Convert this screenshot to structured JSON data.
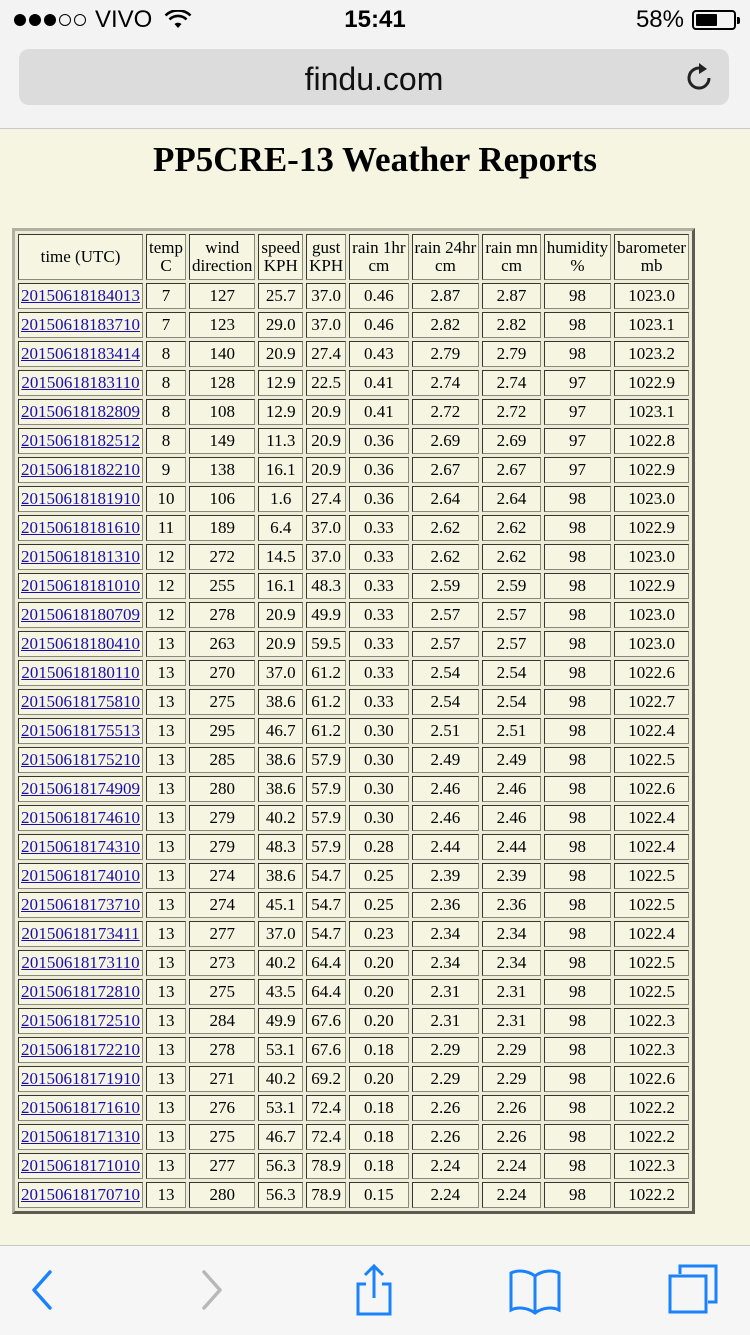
{
  "status": {
    "carrier": "VIVO",
    "time": "15:41",
    "battery": "58%",
    "battery_level": 0.58,
    "signal_bars": 3
  },
  "browser": {
    "url": "findu.com",
    "icons": {
      "reload": "reload-icon",
      "back": "back-chevron-icon",
      "forward": "forward-chevron-icon",
      "share": "share-icon",
      "bookmarks": "bookmarks-book-icon",
      "tabs": "tabs-icon"
    }
  },
  "page": {
    "title": "PP5CRE-13 Weather Reports",
    "columns": [
      [
        "time (UTC)"
      ],
      [
        "temp",
        "C"
      ],
      [
        "wind",
        "direction"
      ],
      [
        "speed",
        "KPH"
      ],
      [
        "gust",
        "KPH"
      ],
      [
        "rain 1hr",
        "cm"
      ],
      [
        "rain 24hr",
        "cm"
      ],
      [
        "rain mn",
        "cm"
      ],
      [
        "humidity",
        "%"
      ],
      [
        "barometer",
        "mb"
      ]
    ],
    "rows": [
      [
        "20150618184013",
        "7",
        "127",
        "25.7",
        "37.0",
        "0.46",
        "2.87",
        "2.87",
        "98",
        "1023.0"
      ],
      [
        "20150618183710",
        "7",
        "123",
        "29.0",
        "37.0",
        "0.46",
        "2.82",
        "2.82",
        "98",
        "1023.1"
      ],
      [
        "20150618183414",
        "8",
        "140",
        "20.9",
        "27.4",
        "0.43",
        "2.79",
        "2.79",
        "98",
        "1023.2"
      ],
      [
        "20150618183110",
        "8",
        "128",
        "12.9",
        "22.5",
        "0.41",
        "2.74",
        "2.74",
        "97",
        "1022.9"
      ],
      [
        "20150618182809",
        "8",
        "108",
        "12.9",
        "20.9",
        "0.41",
        "2.72",
        "2.72",
        "97",
        "1023.1"
      ],
      [
        "20150618182512",
        "8",
        "149",
        "11.3",
        "20.9",
        "0.36",
        "2.69",
        "2.69",
        "97",
        "1022.8"
      ],
      [
        "20150618182210",
        "9",
        "138",
        "16.1",
        "20.9",
        "0.36",
        "2.67",
        "2.67",
        "97",
        "1022.9"
      ],
      [
        "20150618181910",
        "10",
        "106",
        "1.6",
        "27.4",
        "0.36",
        "2.64",
        "2.64",
        "98",
        "1023.0"
      ],
      [
        "20150618181610",
        "11",
        "189",
        "6.4",
        "37.0",
        "0.33",
        "2.62",
        "2.62",
        "98",
        "1022.9"
      ],
      [
        "20150618181310",
        "12",
        "272",
        "14.5",
        "37.0",
        "0.33",
        "2.62",
        "2.62",
        "98",
        "1023.0"
      ],
      [
        "20150618181010",
        "12",
        "255",
        "16.1",
        "48.3",
        "0.33",
        "2.59",
        "2.59",
        "98",
        "1022.9"
      ],
      [
        "20150618180709",
        "12",
        "278",
        "20.9",
        "49.9",
        "0.33",
        "2.57",
        "2.57",
        "98",
        "1023.0"
      ],
      [
        "20150618180410",
        "13",
        "263",
        "20.9",
        "59.5",
        "0.33",
        "2.57",
        "2.57",
        "98",
        "1023.0"
      ],
      [
        "20150618180110",
        "13",
        "270",
        "37.0",
        "61.2",
        "0.33",
        "2.54",
        "2.54",
        "98",
        "1022.6"
      ],
      [
        "20150618175810",
        "13",
        "275",
        "38.6",
        "61.2",
        "0.33",
        "2.54",
        "2.54",
        "98",
        "1022.7"
      ],
      [
        "20150618175513",
        "13",
        "295",
        "46.7",
        "61.2",
        "0.30",
        "2.51",
        "2.51",
        "98",
        "1022.4"
      ],
      [
        "20150618175210",
        "13",
        "285",
        "38.6",
        "57.9",
        "0.30",
        "2.49",
        "2.49",
        "98",
        "1022.5"
      ],
      [
        "20150618174909",
        "13",
        "280",
        "38.6",
        "57.9",
        "0.30",
        "2.46",
        "2.46",
        "98",
        "1022.6"
      ],
      [
        "20150618174610",
        "13",
        "279",
        "40.2",
        "57.9",
        "0.30",
        "2.46",
        "2.46",
        "98",
        "1022.4"
      ],
      [
        "20150618174310",
        "13",
        "279",
        "48.3",
        "57.9",
        "0.28",
        "2.44",
        "2.44",
        "98",
        "1022.4"
      ],
      [
        "20150618174010",
        "13",
        "274",
        "38.6",
        "54.7",
        "0.25",
        "2.39",
        "2.39",
        "98",
        "1022.5"
      ],
      [
        "20150618173710",
        "13",
        "274",
        "45.1",
        "54.7",
        "0.25",
        "2.36",
        "2.36",
        "98",
        "1022.5"
      ],
      [
        "20150618173411",
        "13",
        "277",
        "37.0",
        "54.7",
        "0.23",
        "2.34",
        "2.34",
        "98",
        "1022.4"
      ],
      [
        "20150618173110",
        "13",
        "273",
        "40.2",
        "64.4",
        "0.20",
        "2.34",
        "2.34",
        "98",
        "1022.5"
      ],
      [
        "20150618172810",
        "13",
        "275",
        "43.5",
        "64.4",
        "0.20",
        "2.31",
        "2.31",
        "98",
        "1022.5"
      ],
      [
        "20150618172510",
        "13",
        "284",
        "49.9",
        "67.6",
        "0.20",
        "2.31",
        "2.31",
        "98",
        "1022.3"
      ],
      [
        "20150618172210",
        "13",
        "278",
        "53.1",
        "67.6",
        "0.18",
        "2.29",
        "2.29",
        "98",
        "1022.3"
      ],
      [
        "20150618171910",
        "13",
        "271",
        "40.2",
        "69.2",
        "0.20",
        "2.29",
        "2.29",
        "98",
        "1022.6"
      ],
      [
        "20150618171610",
        "13",
        "276",
        "53.1",
        "72.4",
        "0.18",
        "2.26",
        "2.26",
        "98",
        "1022.2"
      ],
      [
        "20150618171310",
        "13",
        "275",
        "46.7",
        "72.4",
        "0.18",
        "2.26",
        "2.26",
        "98",
        "1022.2"
      ],
      [
        "20150618171010",
        "13",
        "277",
        "56.3",
        "78.9",
        "0.18",
        "2.24",
        "2.24",
        "98",
        "1022.3"
      ],
      [
        "20150618170710",
        "13",
        "280",
        "56.3",
        "78.9",
        "0.15",
        "2.24",
        "2.24",
        "98",
        "1022.2"
      ]
    ]
  },
  "colors": {
    "page_background": "#f5f5e2",
    "link": "#1a0dab",
    "ios_blue": "#1a82fb"
  }
}
